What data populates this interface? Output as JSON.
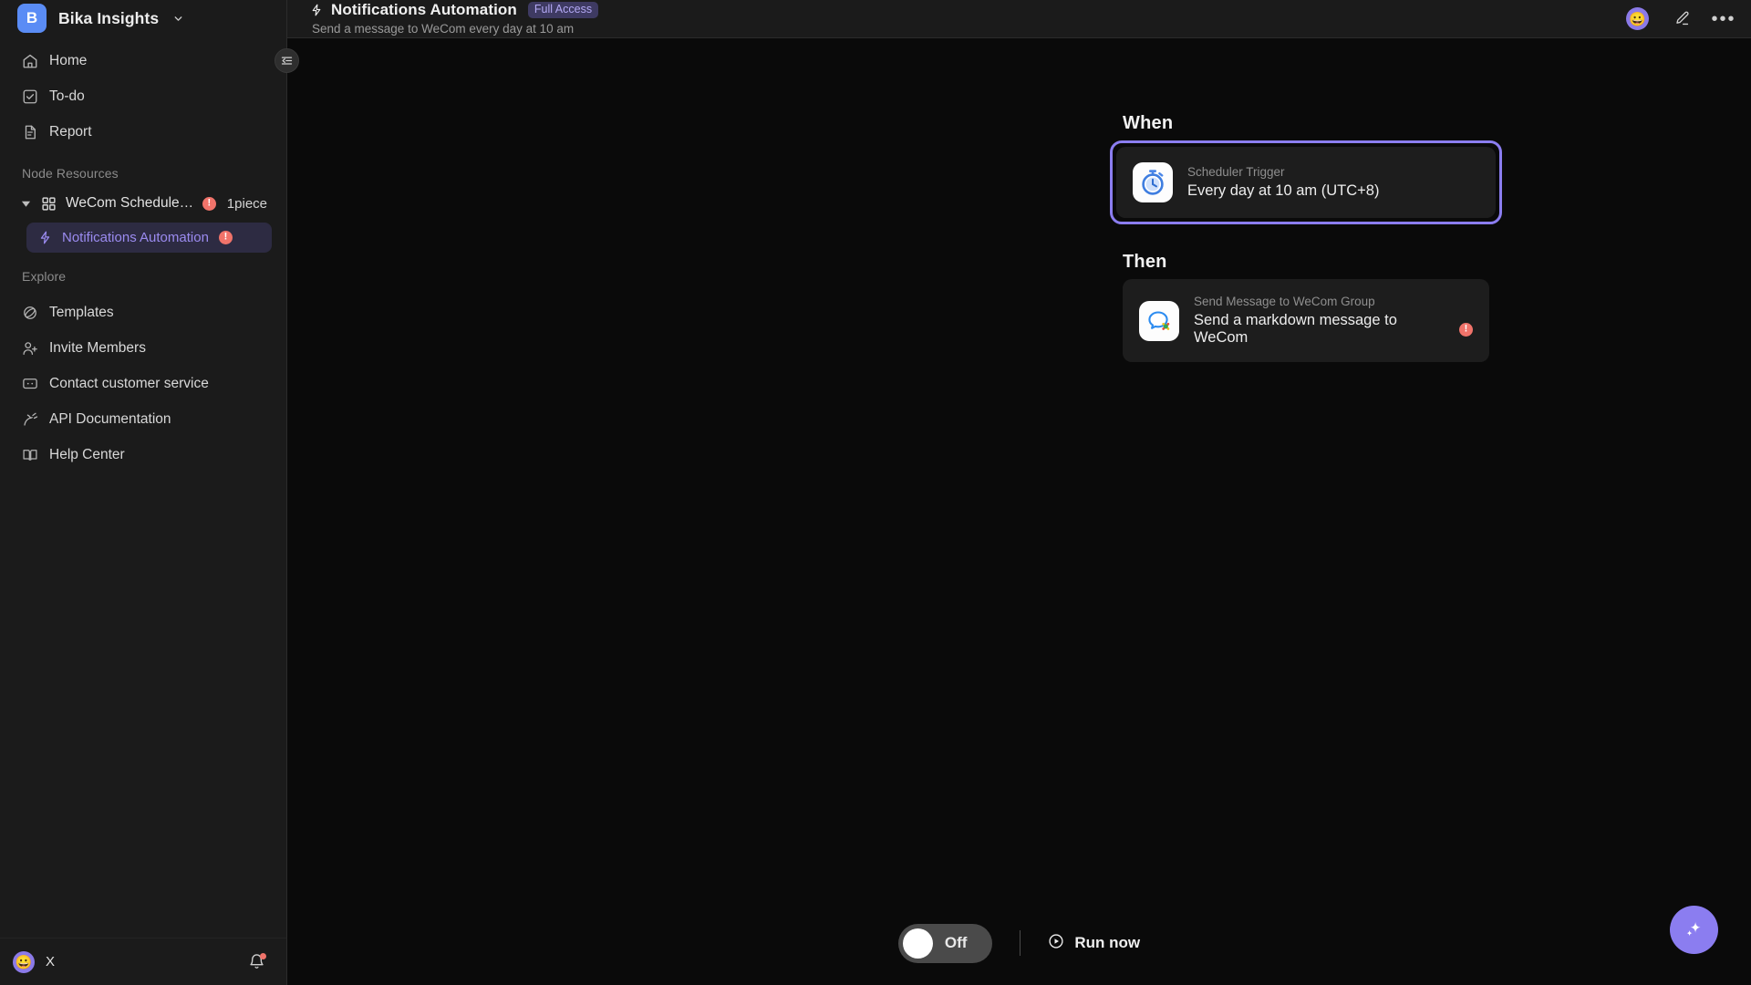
{
  "workspace": {
    "logo_letter": "B",
    "name": "Bika Insights",
    "chevron": "chevron-down"
  },
  "sidebar": {
    "nav": [
      {
        "label": "Home",
        "icon": "home-icon"
      },
      {
        "label": "To-do",
        "icon": "checkbox-icon"
      },
      {
        "label": "Report",
        "icon": "document-icon"
      }
    ],
    "node_resources": {
      "section_label": "Node Resources",
      "node": {
        "title": "WeCom Scheduled...",
        "count_label": "1piece",
        "error_badge": "!",
        "icon": "grid-icon",
        "caret": "caret-down"
      },
      "child": {
        "label": "Notifications Automation",
        "icon": "bolt-icon",
        "error_badge": "!"
      }
    },
    "explore": {
      "section_label": "Explore",
      "items": [
        {
          "label": "Templates",
          "icon": "planet-icon"
        },
        {
          "label": "Invite Members",
          "icon": "user-plus-icon"
        },
        {
          "label": "Contact customer service",
          "icon": "chat-box-icon"
        },
        {
          "label": "API Documentation",
          "icon": "api-icon"
        },
        {
          "label": "Help Center",
          "icon": "book-icon"
        }
      ]
    },
    "user": {
      "avatar_emoji": "😀",
      "name": "X",
      "bell_icon": "bell-icon",
      "has_notification": true
    },
    "collapse_button": "collapse-sidebar-icon"
  },
  "topbar": {
    "bolt_icon": "bolt-icon",
    "title": "Notifications Automation",
    "access_badge": "Full Access",
    "subtitle": "Send a message to WeCom every day at 10 am",
    "avatar_emoji": "😀",
    "edit_icon": "pencil-icon",
    "more_icon": "more-dots-icon",
    "more_glyph": "•••"
  },
  "flow": {
    "when": {
      "label": "When",
      "selected": true,
      "icon": "stopwatch-icon",
      "subtitle": "Scheduler Trigger",
      "title": "Every day at 10 am (UTC+8)"
    },
    "then": {
      "label": "Then",
      "icon": "wecom-chat-icon",
      "subtitle": "Send Message to WeCom Group",
      "title": "Send a markdown message to WeCom",
      "error_badge": "!"
    }
  },
  "bottombar": {
    "toggle_state": "Off",
    "run_now_label": "Run now",
    "run_now_icon": "play-circle-icon"
  },
  "fab": {
    "icon": "sparkle-icon"
  },
  "colors": {
    "accent_purple": "#8b7df0",
    "logo_blue": "#5a8cf5",
    "error_red": "#f0736a",
    "sidebar_bg": "#1b1b1b",
    "canvas_bg": "#0a0a0a",
    "card_bg": "#1d1d1d",
    "selected_item_bg": "#2d2b42",
    "selected_item_text": "#9b8bf0"
  }
}
